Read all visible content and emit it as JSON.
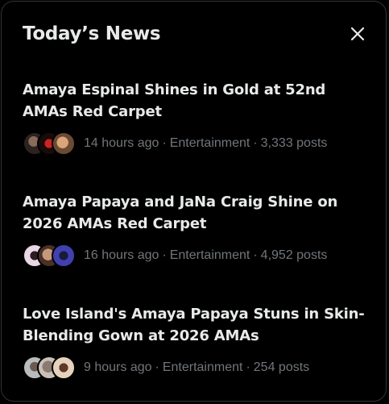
{
  "panel": {
    "title": "Today’s News",
    "close_icon": "close-icon"
  },
  "items": [
    {
      "headline": "Amaya Espinal Shines in Gold at 52nd AMAs Red Carpet",
      "time": "14 hours ago",
      "category": "Entertainment",
      "posts": "3,333 posts",
      "avatar_colors": [
        "#2a2320",
        "#8b1d1d",
        "#b07a55"
      ]
    },
    {
      "headline": "Amaya Papaya and JaNa Craig Shine on 2026 AMAs Red Carpet",
      "time": "16 hours ago",
      "category": "Entertainment",
      "posts": "4,952 posts",
      "avatar_colors": [
        "#c9b6c8",
        "#6a4a3c",
        "#3a3a9a"
      ]
    },
    {
      "headline": "Love Island's Amaya Papaya Stuns in Skin-Blending Gown at 2026 AMAs",
      "time": "9 hours ago",
      "category": "Entertainment",
      "posts": "254 posts",
      "avatar_colors": [
        "#b0b3b4",
        "#8a7a70",
        "#d9c2a8"
      ]
    }
  ]
}
